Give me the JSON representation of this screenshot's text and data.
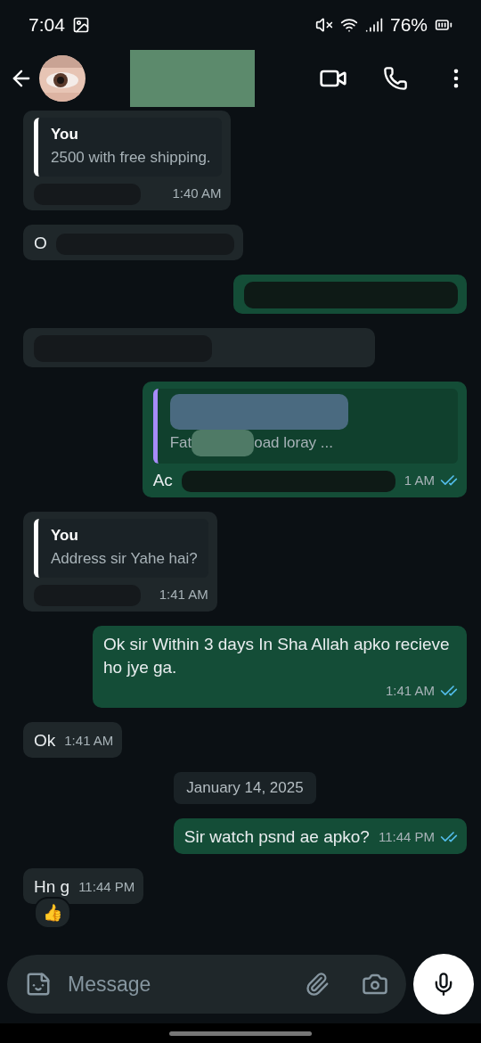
{
  "status_bar": {
    "time": "7:04",
    "battery": "76%"
  },
  "messages": [
    {
      "kind": "incoming",
      "quote": {
        "author": "You",
        "text": "2500 with free shipping."
      },
      "time": "1:40 AM",
      "redacted": true
    },
    {
      "kind": "incoming",
      "text": "O",
      "redacted": true
    },
    {
      "kind": "outgoing",
      "redacted": true
    },
    {
      "kind": "incoming",
      "redacted": true
    },
    {
      "kind": "outgoing",
      "quote": {
        "text": "Fat",
        "text_2": "oad loray ..."
      },
      "text": "Ac",
      "time": "1 AM",
      "read": true,
      "redacted": true
    },
    {
      "kind": "incoming",
      "quote": {
        "author": "You",
        "text": "Address sir Yahe hai?"
      },
      "time": "1:41 AM",
      "redacted": true
    },
    {
      "kind": "outgoing",
      "text": "Ok sir Within 3 days In Sha Allah apko recieve ho jye ga.",
      "time": "1:41 AM",
      "read": true
    },
    {
      "kind": "incoming",
      "text": "Ok",
      "time": "1:41 AM"
    },
    {
      "kind": "date",
      "text": "January 14, 2025"
    },
    {
      "kind": "outgoing",
      "text": "Sir watch psnd ae apko?",
      "time": "11:44 PM",
      "read": true
    },
    {
      "kind": "incoming",
      "text": "Hn g",
      "time": "11:44 PM",
      "reaction": "👍"
    }
  ],
  "composer": {
    "placeholder": "Message"
  }
}
